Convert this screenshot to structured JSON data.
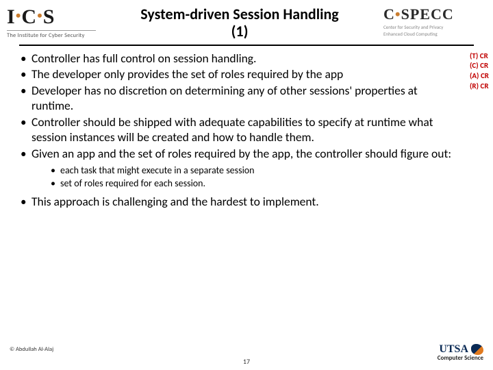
{
  "header": {
    "ics_logo_text": "I",
    "ics_logo_text2": "C",
    "ics_logo_text3": "S",
    "ics_sub": "The Institute for Cyber Security",
    "title_line1": "System-driven Session Handling",
    "title_line2": "(1)",
    "cspecc_text": "C",
    "cspecc_text2": "SPECC",
    "cspecc_sub1": "Center for Security and Privacy",
    "cspecc_sub2": "Enhanced Cloud Computing"
  },
  "bullets": {
    "b1": "Controller has full control on session handling.",
    "b2": "The developer only provides the set of roles required by the app",
    "b3": "Developer has no discretion on determining any of other sessions' properties at runtime.",
    "b4": "Controller should be shipped with adequate capabilities to specify at runtime what session instances will be created and how to handle them.",
    "b5": "Given an app and the set of roles required by the app, the controller should figure out:",
    "s1": "each task that might execute in a separate session",
    "s2": "set of roles required for each session.",
    "b6": "This approach is challenging and the hardest to implement."
  },
  "annotations": {
    "a1": "(T) CR",
    "a2": "(C) CR",
    "a3": "(A) CR",
    "a4": "(R) CR"
  },
  "footer": {
    "copyright": "© Abdullah Al-Alaj",
    "page": "17",
    "utsa": "UTSA",
    "utsa_sub": "Computer Science"
  }
}
